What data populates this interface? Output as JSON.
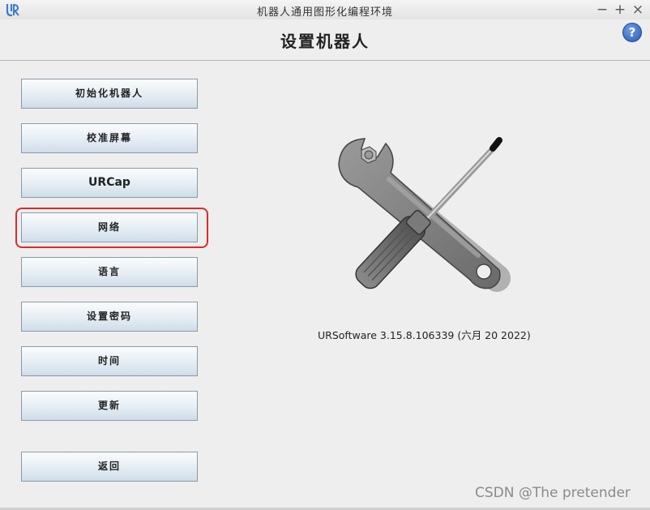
{
  "window": {
    "title": "机器人通用图形化编程环境",
    "minimize": "−",
    "maximize": "+",
    "close": "×"
  },
  "header": {
    "title": "设置机器人",
    "help": "?"
  },
  "menu": {
    "init_robot": "初始化机器人",
    "calibrate_screen": "校准屏幕",
    "urcap": "URCap",
    "network": "网络",
    "language": "语言",
    "set_password": "设置密码",
    "time": "时间",
    "update": "更新",
    "back": "返回"
  },
  "version": "URSoftware 3.15.8.106339 (六月 20 2022)",
  "watermark": "CSDN @The  pretender",
  "icons": {
    "logo": "ur-logo-icon",
    "help": "help-icon",
    "tools": "wrench-screwdriver-icon"
  },
  "colors": {
    "highlight": "#d92b2b",
    "help": "#2a5ab8",
    "logo": "#3a7bd5"
  }
}
